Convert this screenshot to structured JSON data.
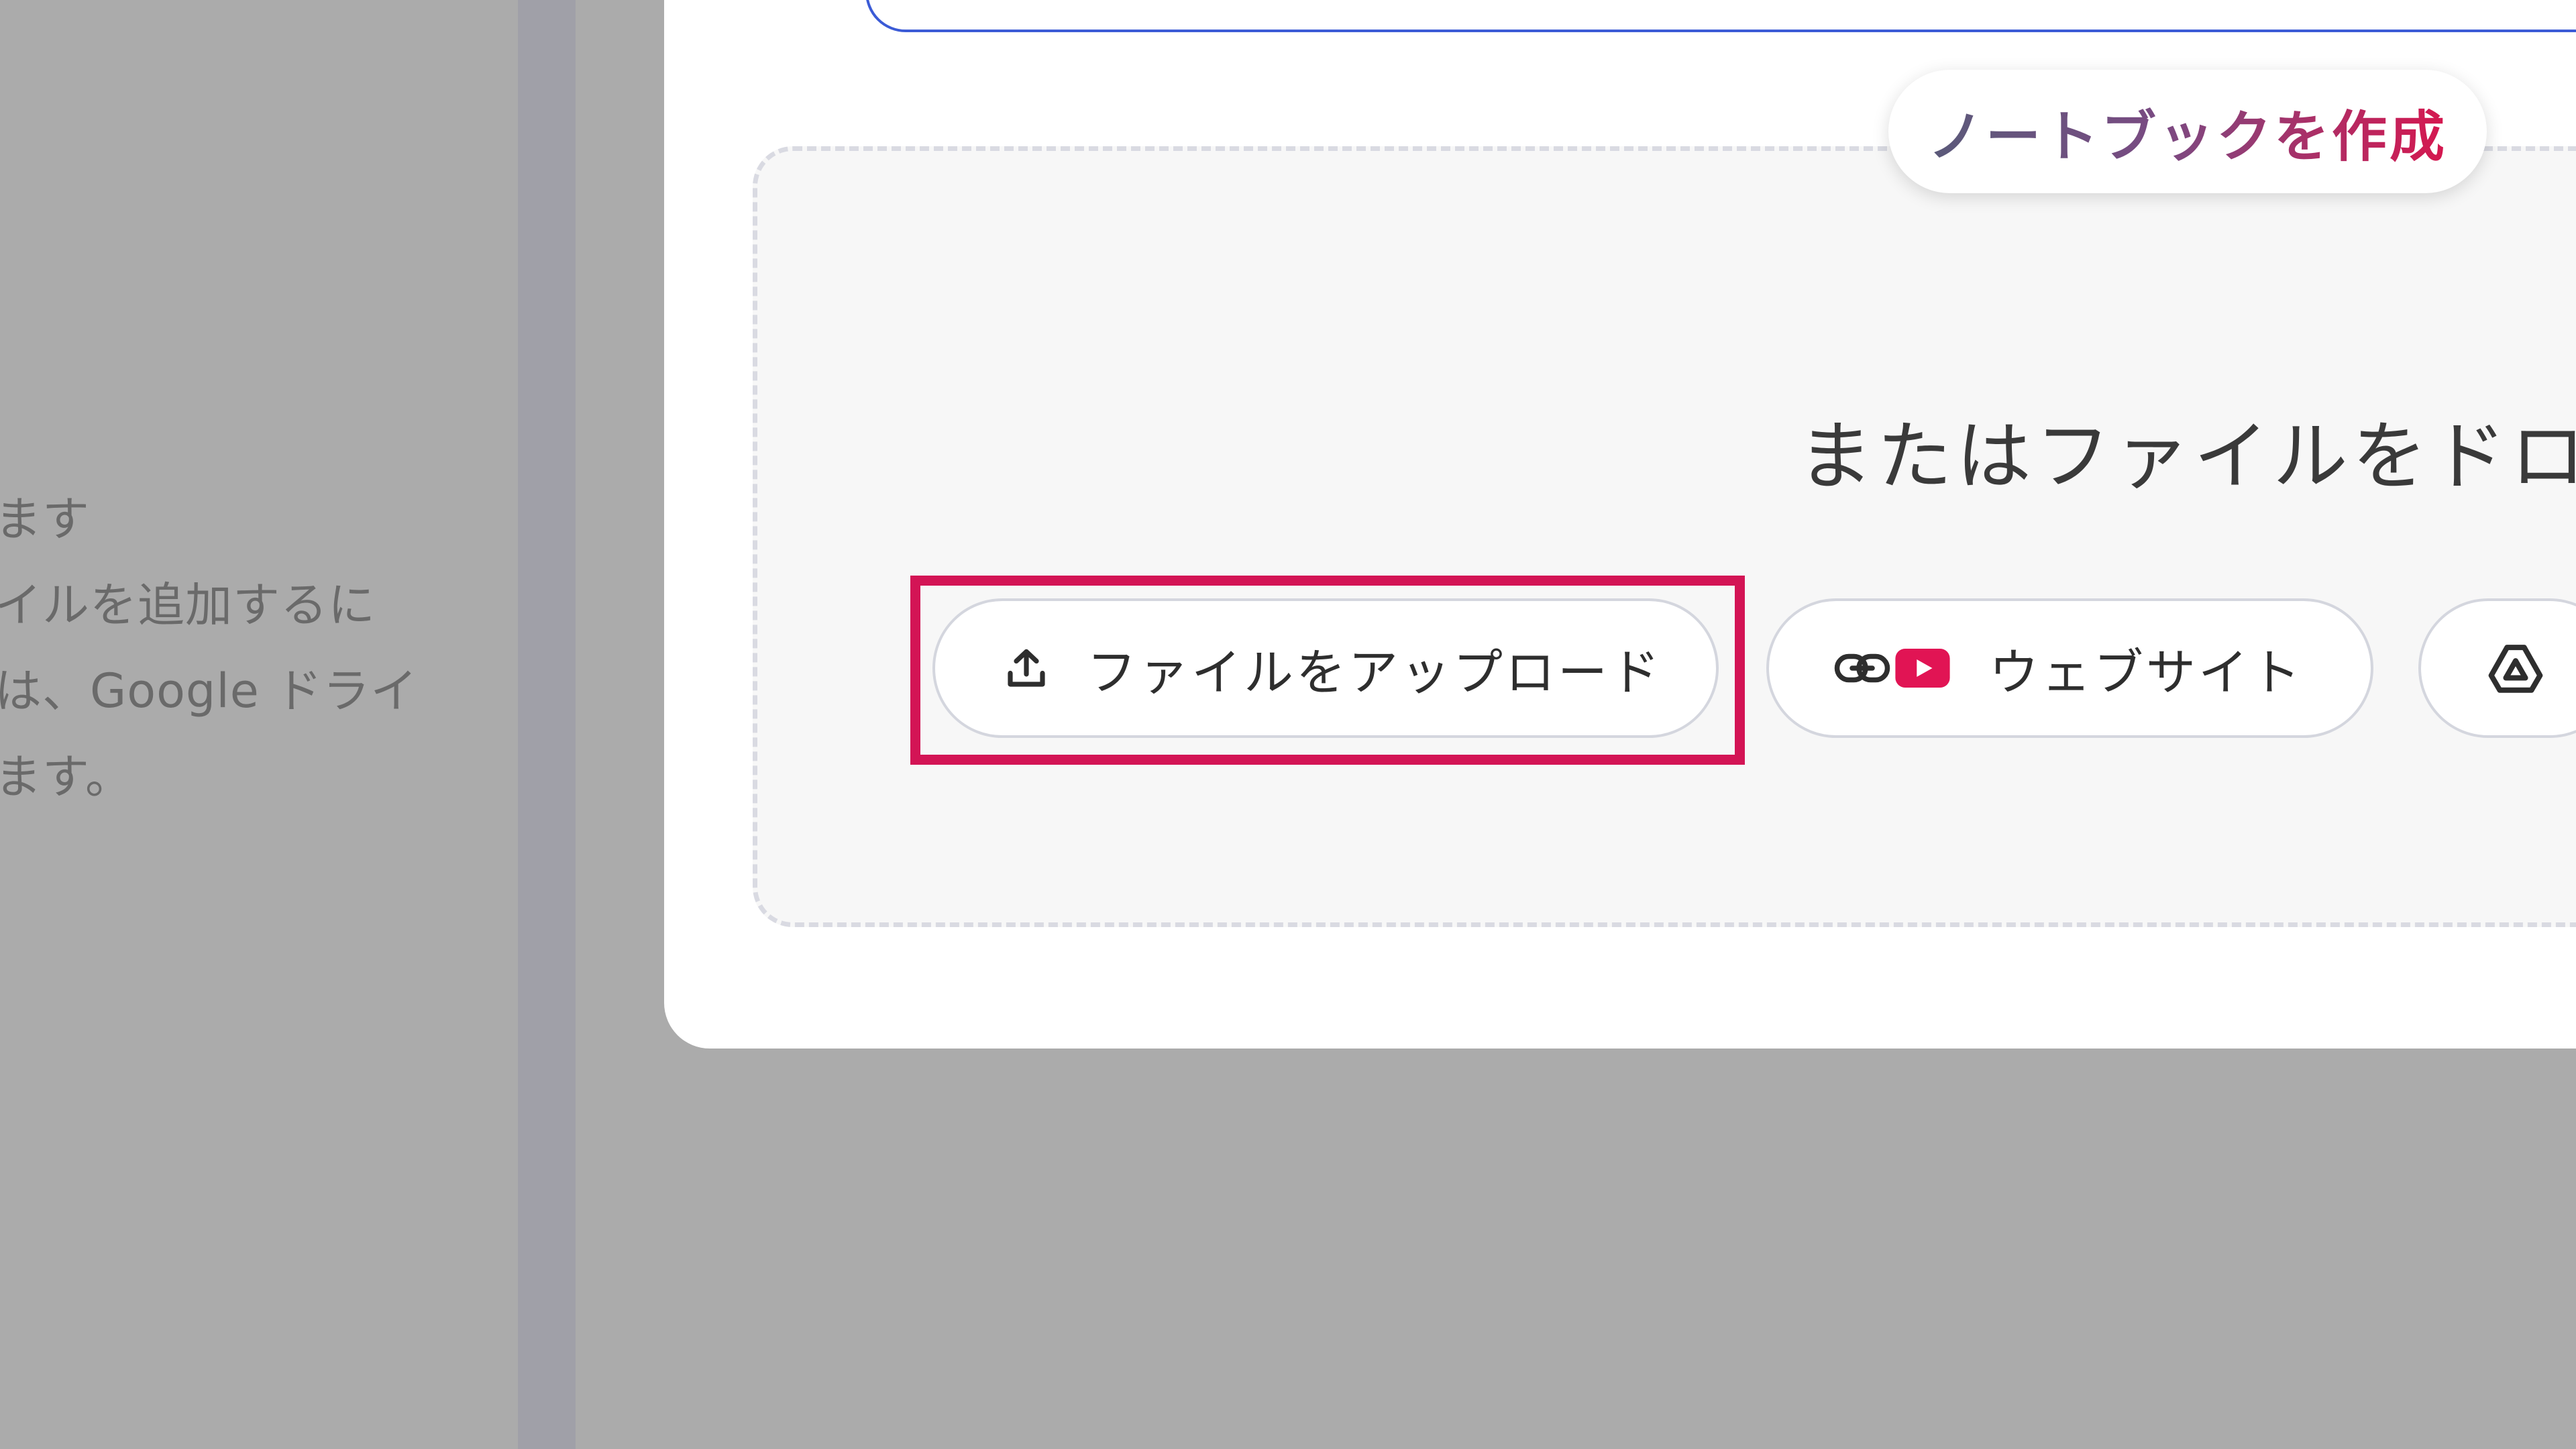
{
  "left_panel": {
    "lines": [
      "ます",
      "イルを追加するに",
      "は、Google ドライ",
      "ます。"
    ]
  },
  "dialog": {
    "create_notebook_label": "ノートブックを作成",
    "drop_hint": "またはファイルをドロ",
    "sources": {
      "upload_label": "ファイルをアップロード",
      "website_label": "ウェブサイト",
      "drive_icon": "google-drive-icon"
    }
  },
  "colors": {
    "accent_red": "#d31455",
    "youtube_red": "#e11454",
    "field_border_blue": "#3b5bd6"
  },
  "icons": {
    "upload": "upload-icon",
    "link": "link-icon",
    "youtube": "youtube-icon"
  }
}
